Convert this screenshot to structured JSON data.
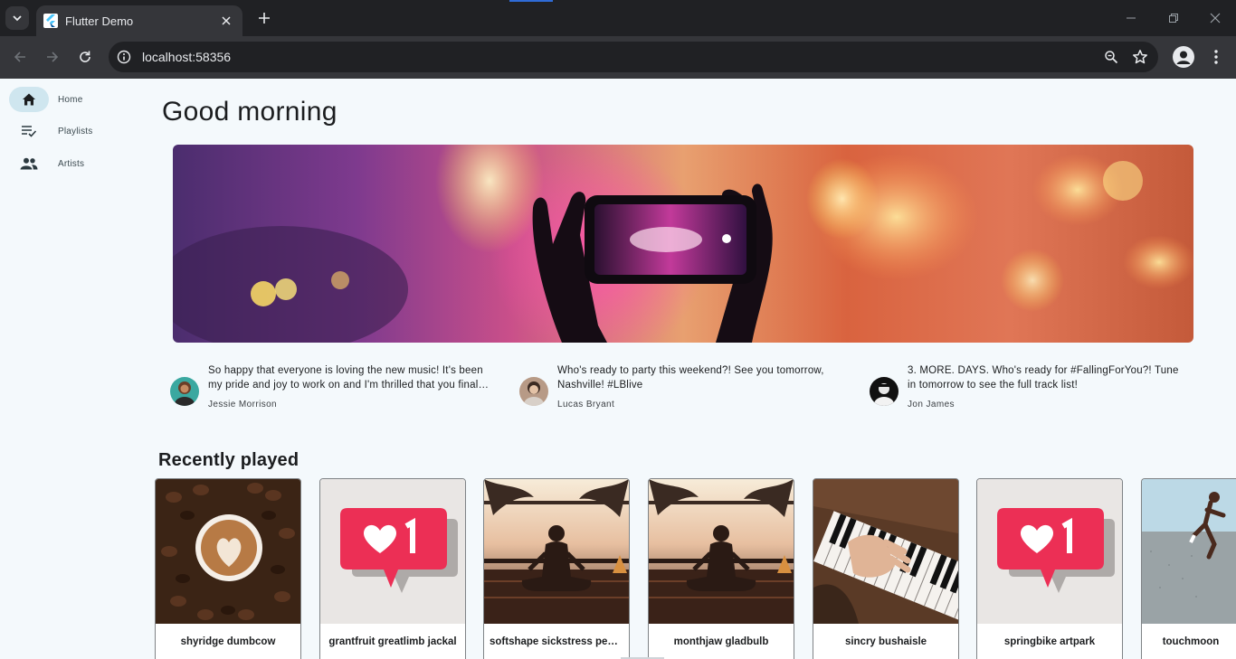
{
  "browser": {
    "tab_title": "Flutter Demo",
    "url": "localhost:58356"
  },
  "rail": {
    "items": [
      {
        "label": "Home",
        "icon": "home-icon",
        "active": true
      },
      {
        "label": "Playlists",
        "icon": "playlist-check-icon",
        "active": false
      },
      {
        "label": "Artists",
        "icon": "people-icon",
        "active": false
      }
    ]
  },
  "main": {
    "greeting": "Good morning",
    "news": [
      {
        "text": "So happy that everyone is loving the new music! It's been my pride and joy to work on and I'm thrilled that you finally get to hear it.",
        "author": "Jessie Morrison"
      },
      {
        "text": "Who's ready to party this weekend?! See you tomorrow, Nashville! #LBlive",
        "author": "Lucas Bryant"
      },
      {
        "text": "3. MORE. DAYS. Who's ready for #FallingForYou?! Tune in tomorrow to see the full track list!",
        "author": "Jon James"
      }
    ],
    "recently_played_title": "Recently played",
    "recently_played": [
      {
        "label": "shyridge dumbcow",
        "art": "coffee"
      },
      {
        "label": "grantfruit greatlimb jackal",
        "art": "like"
      },
      {
        "label": "softshape sickstress penguin",
        "art": "yoga"
      },
      {
        "label": "monthjaw gladbulb",
        "art": "yoga"
      },
      {
        "label": "sincry bushaisle",
        "art": "piano"
      },
      {
        "label": "springbike artpark",
        "art": "like"
      },
      {
        "label": "touchmoon",
        "art": "runner"
      }
    ]
  },
  "colors": {
    "background": "#f4f9fc",
    "rail_active": "#cfe6ef",
    "chrome_dark": "#202124",
    "chrome_mid": "#35363a"
  }
}
